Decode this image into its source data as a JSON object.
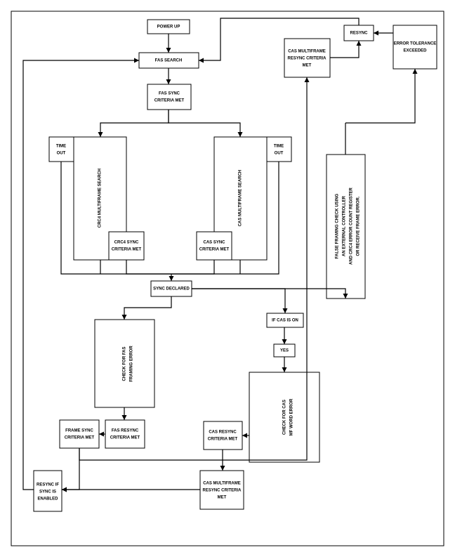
{
  "chart_data": {
    "type": "diagram",
    "title": "",
    "nodes": [
      {
        "id": "powerup",
        "label": "POWER UP"
      },
      {
        "id": "fas_search",
        "label": "FAS SEARCH"
      },
      {
        "id": "fas_sync_met",
        "label": "FAS  SYNC CRITERIA MET"
      },
      {
        "id": "crc4_search",
        "label": "CRC4 MULTIFRAME SEARCH"
      },
      {
        "id": "cas_search",
        "label": "CAS MULTIFRAME SEARCH"
      },
      {
        "id": "time_out_left",
        "label": "TIME OUT"
      },
      {
        "id": "time_out_right",
        "label": "TIME OUT"
      },
      {
        "id": "crc4_sync_met",
        "label": "CRC4 SYNC CRITERIA MET"
      },
      {
        "id": "cas_sync_met",
        "label": "CAS SYNC CRITERIA MET"
      },
      {
        "id": "sync_declared",
        "label": "SYNC DECLARED"
      },
      {
        "id": "check_fas_err",
        "label": "CHECK FOR FAS FRAMING  ERROR"
      },
      {
        "id": "fas_resync_met",
        "label": "FAS RESYNC CRITERIA MET"
      },
      {
        "id": "frame_sync_met",
        "label": "FRAME SYNC CRITERIA MET"
      },
      {
        "id": "resync_if_enabled",
        "label": "RESYNC IF SYNC IS ENABLED"
      },
      {
        "id": "cas_mf_resync_tl",
        "label": "CAS MULTIFRAME RESYNC CRITERIA MET"
      },
      {
        "id": "resync",
        "label": "RESYNC"
      },
      {
        "id": "if_cas_on",
        "label": "IF CAS IS ON"
      },
      {
        "id": "yes",
        "label": "YES"
      },
      {
        "id": "check_cas_mf_err",
        "label": "CHECK FOR CAS MF WORD ERROR"
      },
      {
        "id": "cas_resync_met",
        "label": "CAS RESYNC CRITERIA MET"
      },
      {
        "id": "cas_mf_resync_bl",
        "label": "CAS MULTIFRAME RESYNC CRITERIA MET"
      },
      {
        "id": "false_framing",
        "label": "FALSE FRAMING CHECK USING AN EXTERNAL CONTROLLER AND CRC4 ERROR COUNT REGISTER OR RECEIVE FRAME ERROR."
      },
      {
        "id": "err_tol_exceeded",
        "label": "ERROR TOLERANCE EXCEEDED"
      }
    ],
    "edges": [
      [
        "powerup",
        "fas_search"
      ],
      [
        "fas_search",
        "fas_sync_met"
      ],
      [
        "fas_sync_met",
        "crc4_search"
      ],
      [
        "fas_sync_met",
        "cas_search"
      ],
      [
        "crc4_search",
        "time_out_left"
      ],
      [
        "crc4_search",
        "crc4_sync_met"
      ],
      [
        "cas_search",
        "time_out_right"
      ],
      [
        "cas_search",
        "cas_sync_met"
      ],
      [
        "crc4_sync_met",
        "sync_declared"
      ],
      [
        "time_out_left",
        "sync_declared"
      ],
      [
        "time_out_right",
        "sync_declared"
      ],
      [
        "cas_sync_met",
        "sync_declared"
      ],
      [
        "sync_declared",
        "check_fas_err"
      ],
      [
        "check_fas_err",
        "fas_resync_met"
      ],
      [
        "fas_resync_met",
        "frame_sync_met"
      ],
      [
        "frame_sync_met",
        "resync_if_enabled"
      ],
      [
        "frame_sync_met",
        "cas_mf_resync_tl"
      ],
      [
        "cas_mf_resync_tl",
        "resync"
      ],
      [
        "resync",
        "fas_search"
      ],
      [
        "resync_if_enabled",
        "fas_search"
      ],
      [
        "sync_declared",
        "if_cas_on"
      ],
      [
        "if_cas_on",
        "yes"
      ],
      [
        "yes",
        "check_cas_mf_err"
      ],
      [
        "check_cas_mf_err",
        "cas_resync_met"
      ],
      [
        "cas_resync_met",
        "cas_mf_resync_bl"
      ],
      [
        "cas_mf_resync_bl",
        "resync_if_enabled"
      ],
      [
        "sync_declared",
        "false_framing"
      ],
      [
        "false_framing",
        "err_tol_exceeded"
      ],
      [
        "err_tol_exceeded",
        "resync"
      ]
    ]
  }
}
